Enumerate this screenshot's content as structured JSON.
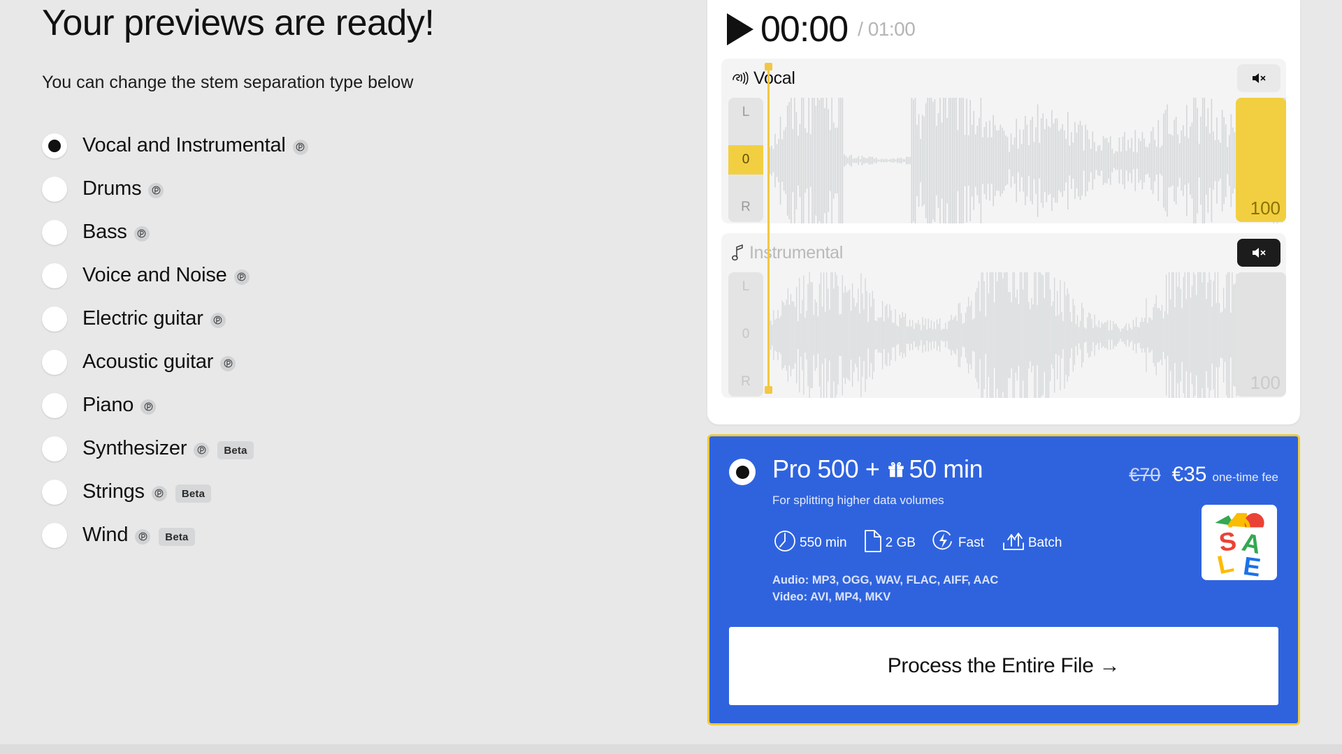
{
  "heading": {
    "title": "Your previews are ready!",
    "subtitle": "You can change the stem separation type below"
  },
  "stem_options": [
    {
      "label": "Vocal and Instrumental",
      "selected": true,
      "pro": true,
      "beta": ""
    },
    {
      "label": "Drums",
      "selected": false,
      "pro": true,
      "beta": ""
    },
    {
      "label": "Bass",
      "selected": false,
      "pro": true,
      "beta": ""
    },
    {
      "label": "Voice and Noise",
      "selected": false,
      "pro": true,
      "beta": ""
    },
    {
      "label": "Electric guitar",
      "selected": false,
      "pro": true,
      "beta": ""
    },
    {
      "label": "Acoustic guitar",
      "selected": false,
      "pro": true,
      "beta": ""
    },
    {
      "label": "Piano",
      "selected": false,
      "pro": true,
      "beta": ""
    },
    {
      "label": "Synthesizer",
      "selected": false,
      "pro": true,
      "beta": "Beta"
    },
    {
      "label": "Strings",
      "selected": false,
      "pro": true,
      "beta": "Beta"
    },
    {
      "label": "Wind",
      "selected": false,
      "pro": true,
      "beta": "Beta"
    }
  ],
  "player": {
    "current_time": "00:00",
    "total_time": "/ 01:00",
    "play_icon": "play-icon",
    "tracks": [
      {
        "name": "Vocal",
        "icon": "voice-icon",
        "muted": false,
        "pan_labels": {
          "left": "L",
          "center": "0",
          "right": "R"
        },
        "volume": "100"
      },
      {
        "name": "Instrumental",
        "icon": "music-note-icon",
        "muted": true,
        "pan_labels": {
          "left": "L",
          "center": "0",
          "right": "R"
        },
        "volume": "100"
      }
    ]
  },
  "pro_offer": {
    "selected": true,
    "title_main": "Pro 500 +",
    "title_bonus": "50 min",
    "gift_icon": "gift-icon",
    "subtitle": "For splitting higher data volumes",
    "price_old": "€70",
    "price_new": "€35",
    "price_note": "one-time fee",
    "features": [
      {
        "icon": "clock-icon",
        "label": "550 min"
      },
      {
        "icon": "file-icon",
        "label": "2 GB"
      },
      {
        "icon": "bolt-icon",
        "label": "Fast"
      },
      {
        "icon": "batch-upload-icon",
        "label": "Batch"
      }
    ],
    "formats_audio": "Audio: MP3, OGG, WAV, FLAC, AIFF, AAC",
    "formats_video": "Video: AVI, MP4, MKV",
    "sale_badge_icon": "sale-shopping-bag-icon",
    "cta_label": "Process the Entire File →"
  },
  "colors": {
    "page_bg": "#e8e8e8",
    "accent_yellow": "#f2c744",
    "brand_blue": "#2f63de",
    "card_white": "#ffffff",
    "waveform_gray": "#d3d6d8"
  }
}
